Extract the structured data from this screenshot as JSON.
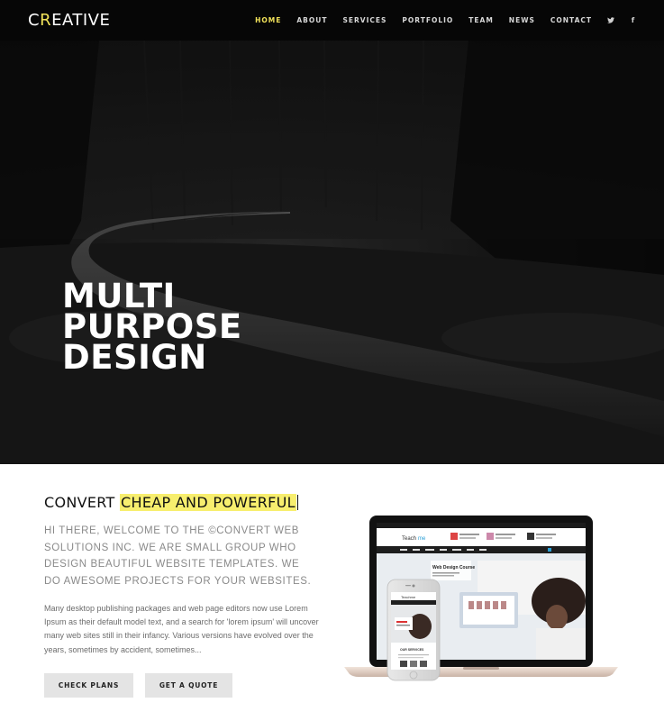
{
  "nav": {
    "logo_prefix": "C",
    "logo_accent": "R",
    "logo_rest": "EATIVE",
    "items": [
      {
        "label": "HOME",
        "active": true
      },
      {
        "label": "ABOUT"
      },
      {
        "label": "SERVICES"
      },
      {
        "label": "PORTFOLIO"
      },
      {
        "label": "TEAM"
      },
      {
        "label": "NEWS"
      },
      {
        "label": "CONTACT"
      }
    ],
    "social": [
      {
        "icon": "twitter-icon",
        "glyph": "❧"
      },
      {
        "icon": "facebook-icon",
        "glyph": "f"
      }
    ],
    "accent_color": "#f2e35a"
  },
  "hero": {
    "title_lines": [
      "MULTI",
      "PURPOSE",
      "DESIGN"
    ]
  },
  "about": {
    "headline_prefix": "CONVERT ",
    "headline_highlight": "CHEAP AND POWERFUL",
    "highlight_color": "#f7ee6e",
    "intro": "HI THERE, WELCOME TO THE ©CONVERT WEB SOLUTIONS INC. WE ARE SMALL GROUP WHO DESIGN BEAUTIFUL WEBSITE TEMPLATES. WE DO AWESOME PROJECTS FOR YOUR WEBSITES.",
    "body": "Many desktop publishing packages and web page editors now use Lorem Ipsum as their default model text, and a search for 'lorem ipsum' will uncover many web sites still in their infancy. Various versions have evolved over the years, sometimes by accident, sometimes...",
    "buttons": {
      "check_plans": "CHECK PLANS",
      "get_quote": "GET A QUOTE"
    }
  },
  "mockup": {
    "site_logo": "Teachme",
    "course_title": "Web Design Course",
    "course_sub": "Lorem ipsum dolor sit amet",
    "phone_logo": "Teachme",
    "phone_sub": "OUR SERVICES"
  }
}
